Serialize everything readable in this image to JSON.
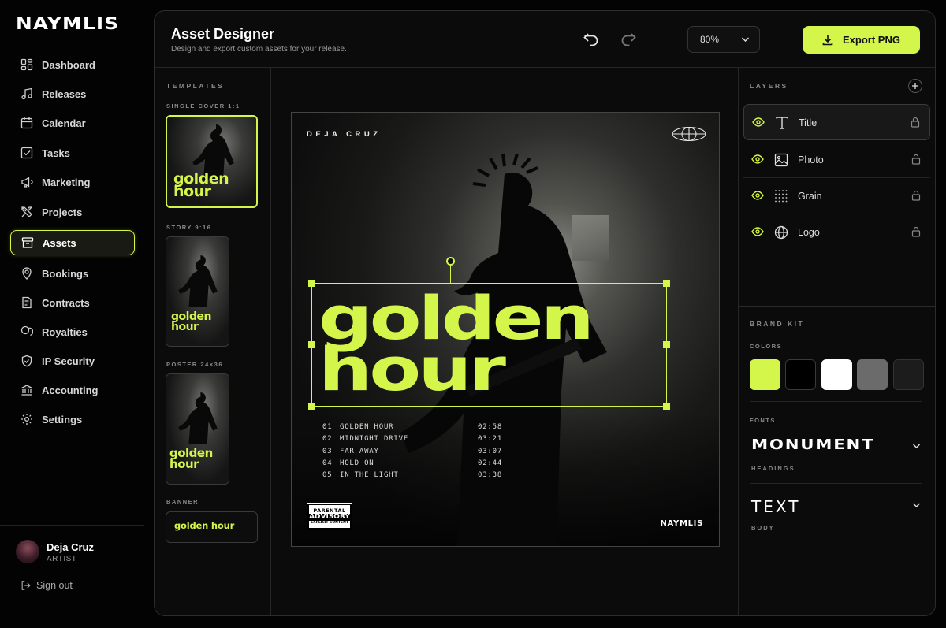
{
  "brand": {
    "logo": "NAYMLIS",
    "accent": "#d4f54a"
  },
  "sidebar": {
    "items": [
      {
        "label": "Dashboard",
        "icon": "dashboard-icon"
      },
      {
        "label": "Releases",
        "icon": "music-note-icon"
      },
      {
        "label": "Calendar",
        "icon": "calendar-icon"
      },
      {
        "label": "Tasks",
        "icon": "checkbox-icon"
      },
      {
        "label": "Marketing",
        "icon": "megaphone-icon"
      },
      {
        "label": "Projects",
        "icon": "tools-icon"
      },
      {
        "label": "Assets",
        "icon": "archive-icon",
        "active": true
      },
      {
        "label": "Bookings",
        "icon": "location-pin-icon"
      },
      {
        "label": "Contracts",
        "icon": "document-icon"
      },
      {
        "label": "Royalties",
        "icon": "coins-icon"
      },
      {
        "label": "IP Security",
        "icon": "shield-icon"
      },
      {
        "label": "Accounting",
        "icon": "bank-icon"
      },
      {
        "label": "Settings",
        "icon": "gear-icon"
      }
    ],
    "user": {
      "name": "Deja Cruz",
      "role": "ARTIST"
    },
    "signout": "Sign out"
  },
  "header": {
    "title": "Asset Designer",
    "subtitle": "Design and export custom assets for your release.",
    "zoom": "80%",
    "export_label": "Export PNG"
  },
  "templates": {
    "heading": "TEMPLATES",
    "groups": [
      {
        "label": "SINGLE COVER 1:1",
        "title_line1": "golden",
        "title_line2": "hour",
        "selected": true
      },
      {
        "label": "STORY 9:16",
        "title_line1": "golden",
        "title_line2": "hour"
      },
      {
        "label": "POSTER 24×36",
        "title_line1": "golden",
        "title_line2": "hour"
      },
      {
        "label": "BANNER",
        "title": "golden hour"
      }
    ]
  },
  "artboard": {
    "artist": "DEJA CRUZ",
    "title_line1": "golden",
    "title_line2": "hour",
    "tracks": [
      {
        "num": "01",
        "title": "GOLDEN HOUR",
        "time": "02:58"
      },
      {
        "num": "02",
        "title": "MIDNIGHT DRIVE",
        "time": "03:21"
      },
      {
        "num": "03",
        "title": "FAR AWAY",
        "time": "03:07"
      },
      {
        "num": "04",
        "title": "HOLD ON",
        "time": "02:44"
      },
      {
        "num": "05",
        "title": "IN THE LIGHT",
        "time": "03:38"
      }
    ],
    "advisory": {
      "line1": "PARENTAL",
      "line2": "ADVISORY",
      "line3": "EXPLICIT CONTENT"
    },
    "brand": "NAYMLIS"
  },
  "layers": {
    "heading": "LAYERS",
    "items": [
      {
        "name": "Title",
        "icon": "text-icon",
        "selected": true
      },
      {
        "name": "Photo",
        "icon": "image-icon"
      },
      {
        "name": "Grain",
        "icon": "grain-grid-icon"
      },
      {
        "name": "Logo",
        "icon": "globe-icon"
      }
    ]
  },
  "brand_kit": {
    "heading": "BRAND KIT",
    "colors_label": "COLORS",
    "colors": [
      "#d4f54a",
      "#000000",
      "#ffffff",
      "#6b6b6b",
      "#1c1c1c"
    ],
    "fonts_label": "FONTS",
    "fonts": [
      {
        "name": "MONUMENT",
        "role": "HEADINGS"
      },
      {
        "name": "TEXT",
        "role": "BODY"
      }
    ]
  }
}
